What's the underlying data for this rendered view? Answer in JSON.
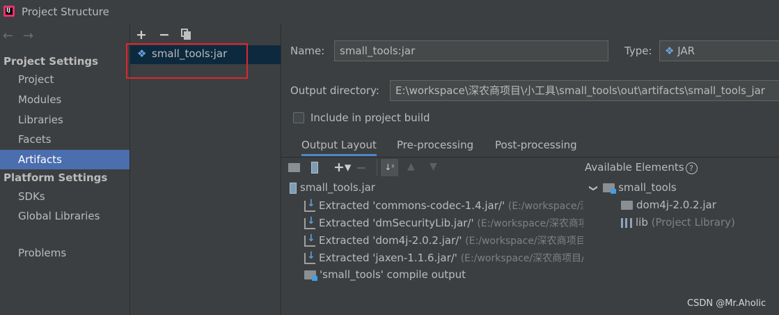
{
  "window": {
    "title": "Project Structure"
  },
  "nav": {
    "back_icon": "arrow-left-icon",
    "forward_icon": "arrow-right-icon",
    "project_settings_header": "Project Settings",
    "project_settings": [
      "Project",
      "Modules",
      "Libraries",
      "Facets",
      "Artifacts"
    ],
    "platform_settings_header": "Platform Settings",
    "platform_settings": [
      "SDKs",
      "Global Libraries"
    ],
    "problems": "Problems",
    "selected": "Artifacts"
  },
  "artifacts": {
    "toolbar": {
      "add": "+",
      "remove": "−",
      "copy_icon": "copy-icon"
    },
    "items": [
      "small_tools:jar"
    ]
  },
  "artifact": {
    "name_label": "Name:",
    "name_value": "small_tools:jar",
    "type_label": "Type:",
    "type_value": "JAR",
    "output_dir_label": "Output directory:",
    "output_dir_value": "E:\\workspace\\深农商项目\\小工具\\small_tools\\out\\artifacts\\small_tools_jar",
    "include_build_label": "Include in project build",
    "include_build_checked": false
  },
  "tabs": [
    "Output Layout",
    "Pre-processing",
    "Post-processing"
  ],
  "active_tab": "Output Layout",
  "layout_tree": {
    "root": "small_tools.jar",
    "children": [
      {
        "label": "Extracted 'commons-codec-1.4.jar/'",
        "hint": "(E:/workspace/深"
      },
      {
        "label": "Extracted 'dmSecurityLib.jar/'",
        "hint": "(E:/workspace/深农商项"
      },
      {
        "label": "Extracted 'dom4j-2.0.2.jar/'",
        "hint": "(E:/workspace/深农商项目"
      },
      {
        "label": "Extracted 'jaxen-1.1.6.jar/'",
        "hint": "(E:/workspace/深农商项目/"
      },
      {
        "label": "'small_tools' compile output",
        "hint": ""
      }
    ]
  },
  "available": {
    "header": "Available Elements",
    "help": "?",
    "root": "small_tools",
    "children": [
      {
        "label": "dom4j-2.0.2.jar",
        "hint": ""
      },
      {
        "label": "lib",
        "hint": "(Project Library)"
      }
    ]
  },
  "watermark": "CSDN @Mr.Aholic"
}
